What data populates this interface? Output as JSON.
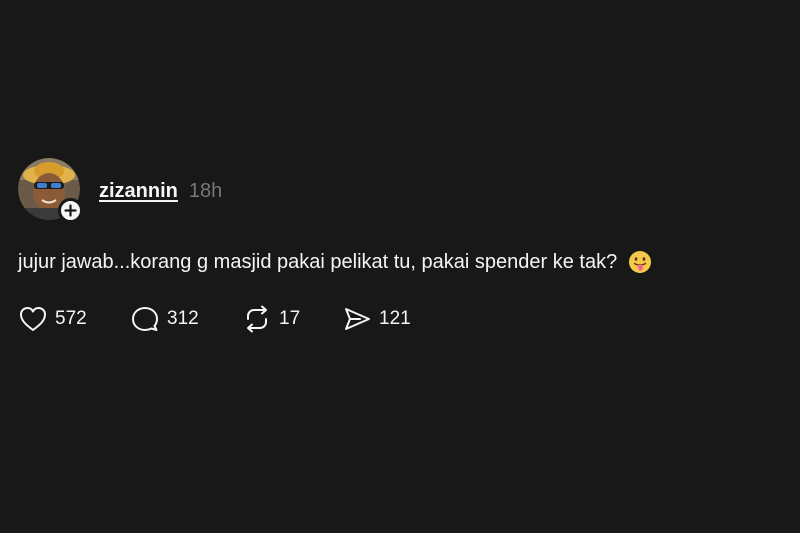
{
  "post": {
    "username": "zizannin",
    "timestamp": "18h",
    "text": "jujur jawab...korang g masjid pakai pelikat tu, pakai spender ke tak?",
    "emoji": "face-with-tongue",
    "follow_icon": "plus-icon",
    "actions": {
      "likes": "572",
      "replies": "312",
      "reposts": "17",
      "shares": "121"
    }
  },
  "colors": {
    "background": "#181818",
    "text": "#f3f5f7",
    "muted": "#777777"
  }
}
